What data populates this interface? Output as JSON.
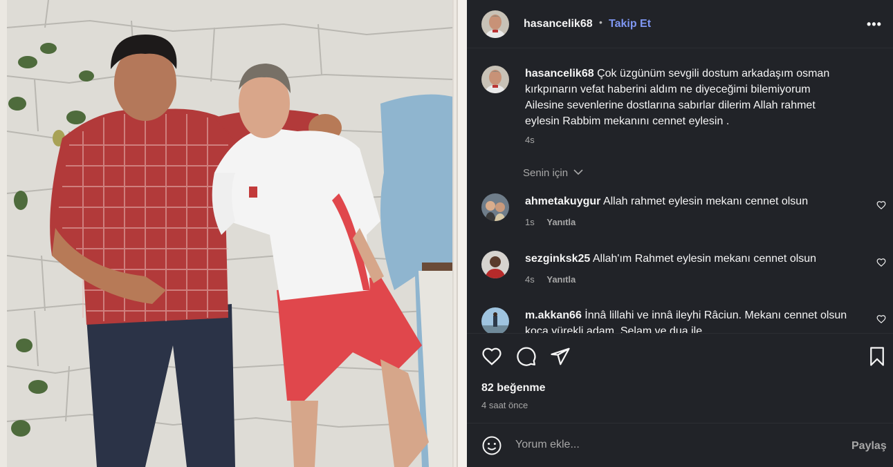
{
  "post": {
    "author": "hasancelik68",
    "separator": "•",
    "follow_label": "Takip Et",
    "more_label": "•••",
    "caption": {
      "user": "hasancelik68",
      "text": "Çok üzgünüm sevgili dostum arkadaşım osman kırkpınarın vefat haberini aldım ne diyeceğimi bilemiyorum Ailesine sevenlerine dostlarına sabırlar dilerim Allah rahmet eylesin Rabbim mekanını cennet eylesin .",
      "time": "4s"
    },
    "filter_label": "Senin için",
    "comments": [
      {
        "user": "ahmetakuygur",
        "text": "Allah rahmet eylesin mekanı cennet olsun",
        "time": "1s",
        "reply_label": "Yanıtla"
      },
      {
        "user": "sezginksk25",
        "text": "Allah'ım Rahmet eylesin mekanı cennet olsun",
        "time": "4s",
        "reply_label": "Yanıtla"
      },
      {
        "user": "m.akkan66",
        "text": "İnnâ lillahi ve innâ ileyhi Râciun. Mekanı cennet olsun koca yürekli adam. Selam ve dua ile.",
        "time": "",
        "reply_label": ""
      }
    ],
    "likes": "82 beğenme",
    "time_ago": "4 saat önce",
    "comment_placeholder": "Yorum ekle...",
    "share_label": "Paylaş",
    "colors": {
      "panel_bg": "#212328",
      "accent_link": "#7f97f2",
      "text_primary": "#f5f5f5",
      "text_secondary": "#a8a8a8"
    }
  }
}
